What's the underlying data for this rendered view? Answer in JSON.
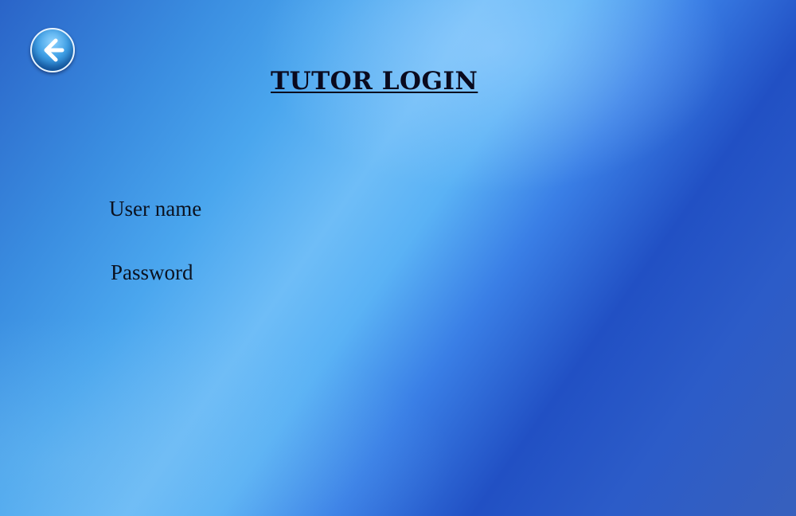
{
  "header": {
    "title": "TUTOR LOGIN",
    "back_icon": "arrow-left-icon"
  },
  "form": {
    "username_label": "User name",
    "password_label": "Password"
  },
  "colors": {
    "background_primary": "#2a64c8",
    "background_highlight": "#6ebdf7",
    "title_text": "#0a0a1e"
  }
}
